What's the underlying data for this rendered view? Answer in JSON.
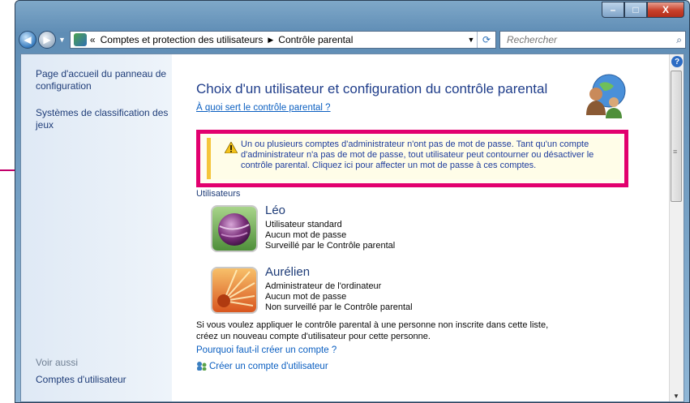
{
  "window": {
    "caption_buttons": {
      "minimize": "–",
      "maximize": "□",
      "close": "X"
    }
  },
  "addressbar": {
    "prefix": "«",
    "breadcrumb": [
      "Comptes et protection des utilisateurs",
      "Contrôle parental"
    ],
    "search_placeholder": "Rechercher"
  },
  "sidebar": {
    "links": [
      "Page d'accueil du panneau de configuration",
      "Systèmes de classification des jeux"
    ],
    "see_also_label": "Voir aussi",
    "see_also_links": [
      "Comptes d'utilisateur"
    ]
  },
  "main": {
    "title": "Choix d'un utilisateur et configuration du contrôle parental",
    "help_link": "À quoi sert le contrôle parental ?",
    "warning": "Un ou plusieurs comptes d'administrateur n'ont pas de mot de passe. Tant qu'un compte d'administrateur n'a pas de mot de passe, tout utilisateur peut contourner ou désactiver le contrôle parental. Cliquez ici pour affecter un mot de passe à ces comptes.",
    "users_heading": "Utilisateurs",
    "users": [
      {
        "name": "Léo",
        "type": "Utilisateur standard",
        "password": "Aucun mot de passe",
        "status": "Surveillé par le Contrôle parental"
      },
      {
        "name": "Aurélien",
        "type": "Administrateur de l'ordinateur",
        "password": "Aucun mot de passe",
        "status": "Non surveillé par le Contrôle parental"
      }
    ],
    "info_text": "Si vous voulez appliquer le contrôle parental à une personne non inscrite dans cette liste, créez un nouveau compte d'utilisateur pour cette personne.",
    "why_link": "Pourquoi faut-il créer un compte ?",
    "create_link": "Créer un compte d'utilisateur"
  },
  "colors": {
    "highlight": "#e2006f",
    "warning_stripe": "#f5c53b",
    "link": "#0b5fc1",
    "heading": "#1f3d8a"
  }
}
